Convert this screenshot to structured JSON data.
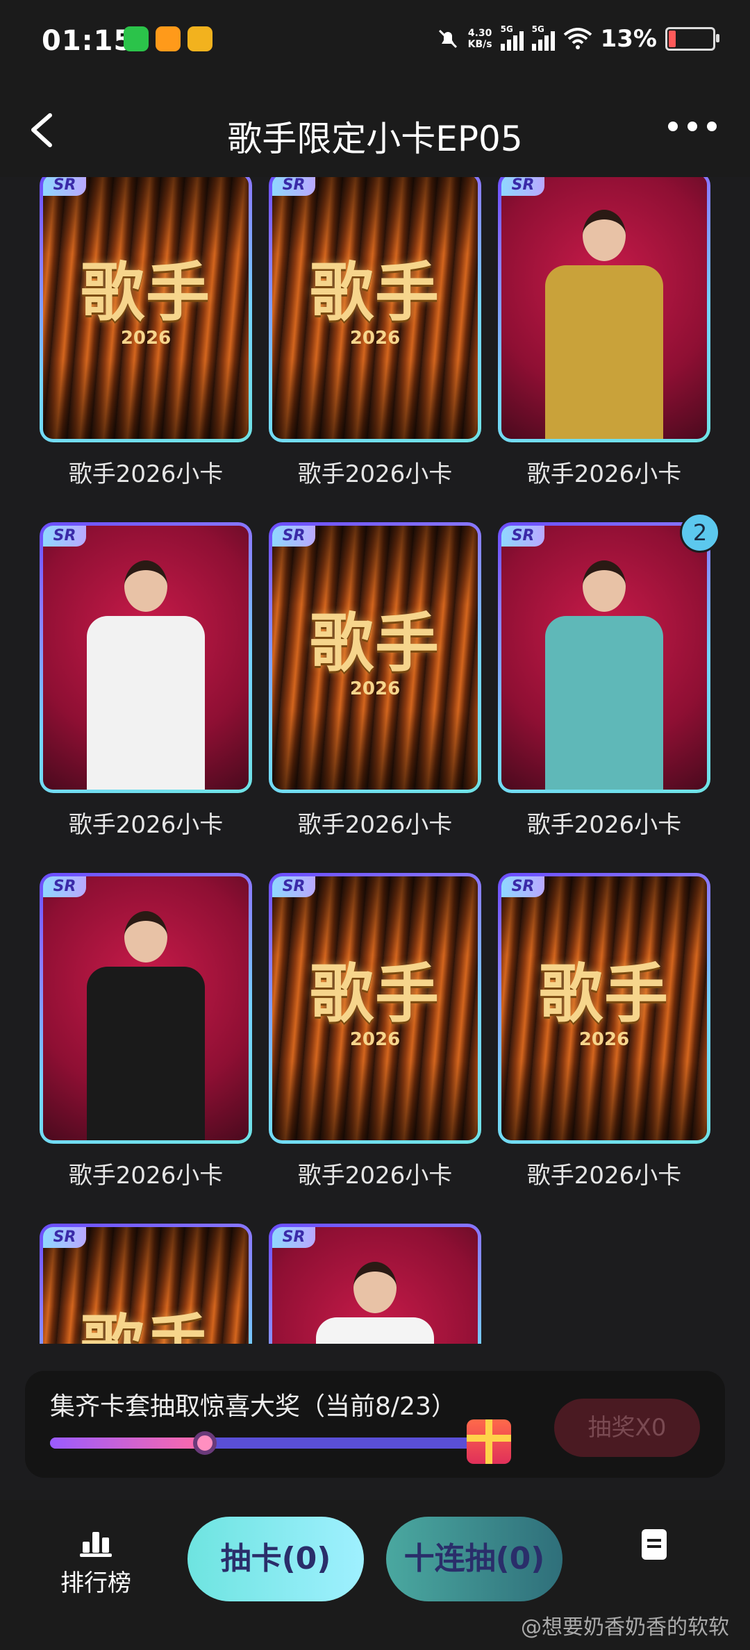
{
  "status_bar": {
    "time": "01:15",
    "net_speed_value": "4.30",
    "net_speed_unit": "KB/s",
    "sig1": "5G",
    "sig2": "5G",
    "battery": "13%"
  },
  "header": {
    "title": "歌手限定小卡EP05"
  },
  "cards": [
    {
      "label": "歌手2026小卡",
      "rarity": "SR",
      "art": "poster",
      "logo": "歌手",
      "year": "2026"
    },
    {
      "label": "歌手2026小卡",
      "rarity": "SR",
      "art": "poster",
      "logo": "歌手",
      "year": "2026"
    },
    {
      "label": "歌手2026小卡",
      "rarity": "SR",
      "art": "portrait",
      "outfit": "#c9a23a"
    },
    {
      "label": "歌手2026小卡",
      "rarity": "SR",
      "art": "portrait",
      "outfit": "#f2f2f2"
    },
    {
      "label": "歌手2026小卡",
      "rarity": "SR",
      "art": "poster",
      "logo": "歌手",
      "year": "2026"
    },
    {
      "label": "歌手2026小卡",
      "rarity": "SR",
      "art": "portrait",
      "outfit": "#5fb8b8",
      "count": "2"
    },
    {
      "label": "歌手2026小卡",
      "rarity": "SR",
      "art": "portrait",
      "outfit": "#1a1a1a"
    },
    {
      "label": "歌手2026小卡",
      "rarity": "SR",
      "art": "poster",
      "logo": "歌手",
      "year": "2026"
    },
    {
      "label": "歌手2026小卡",
      "rarity": "SR",
      "art": "poster",
      "logo": "歌手",
      "year": "2026"
    },
    {
      "label": "",
      "rarity": "SR",
      "art": "poster",
      "logo": "歌手",
      "year": ""
    },
    {
      "label": "",
      "rarity": "SR",
      "art": "portrait",
      "outfit": "#f4f4f4"
    }
  ],
  "progress": {
    "text": "集齐卡套抽取惊喜大奖（当前8/23）",
    "collected": 8,
    "total": 23,
    "lottery_label": "抽奖X0"
  },
  "bottom_nav": {
    "rank_label": "排行榜",
    "draw_label": "抽卡(0)",
    "ten_draw_label": "十连抽(0)"
  },
  "watermark": "@想要奶香奶香的软软"
}
